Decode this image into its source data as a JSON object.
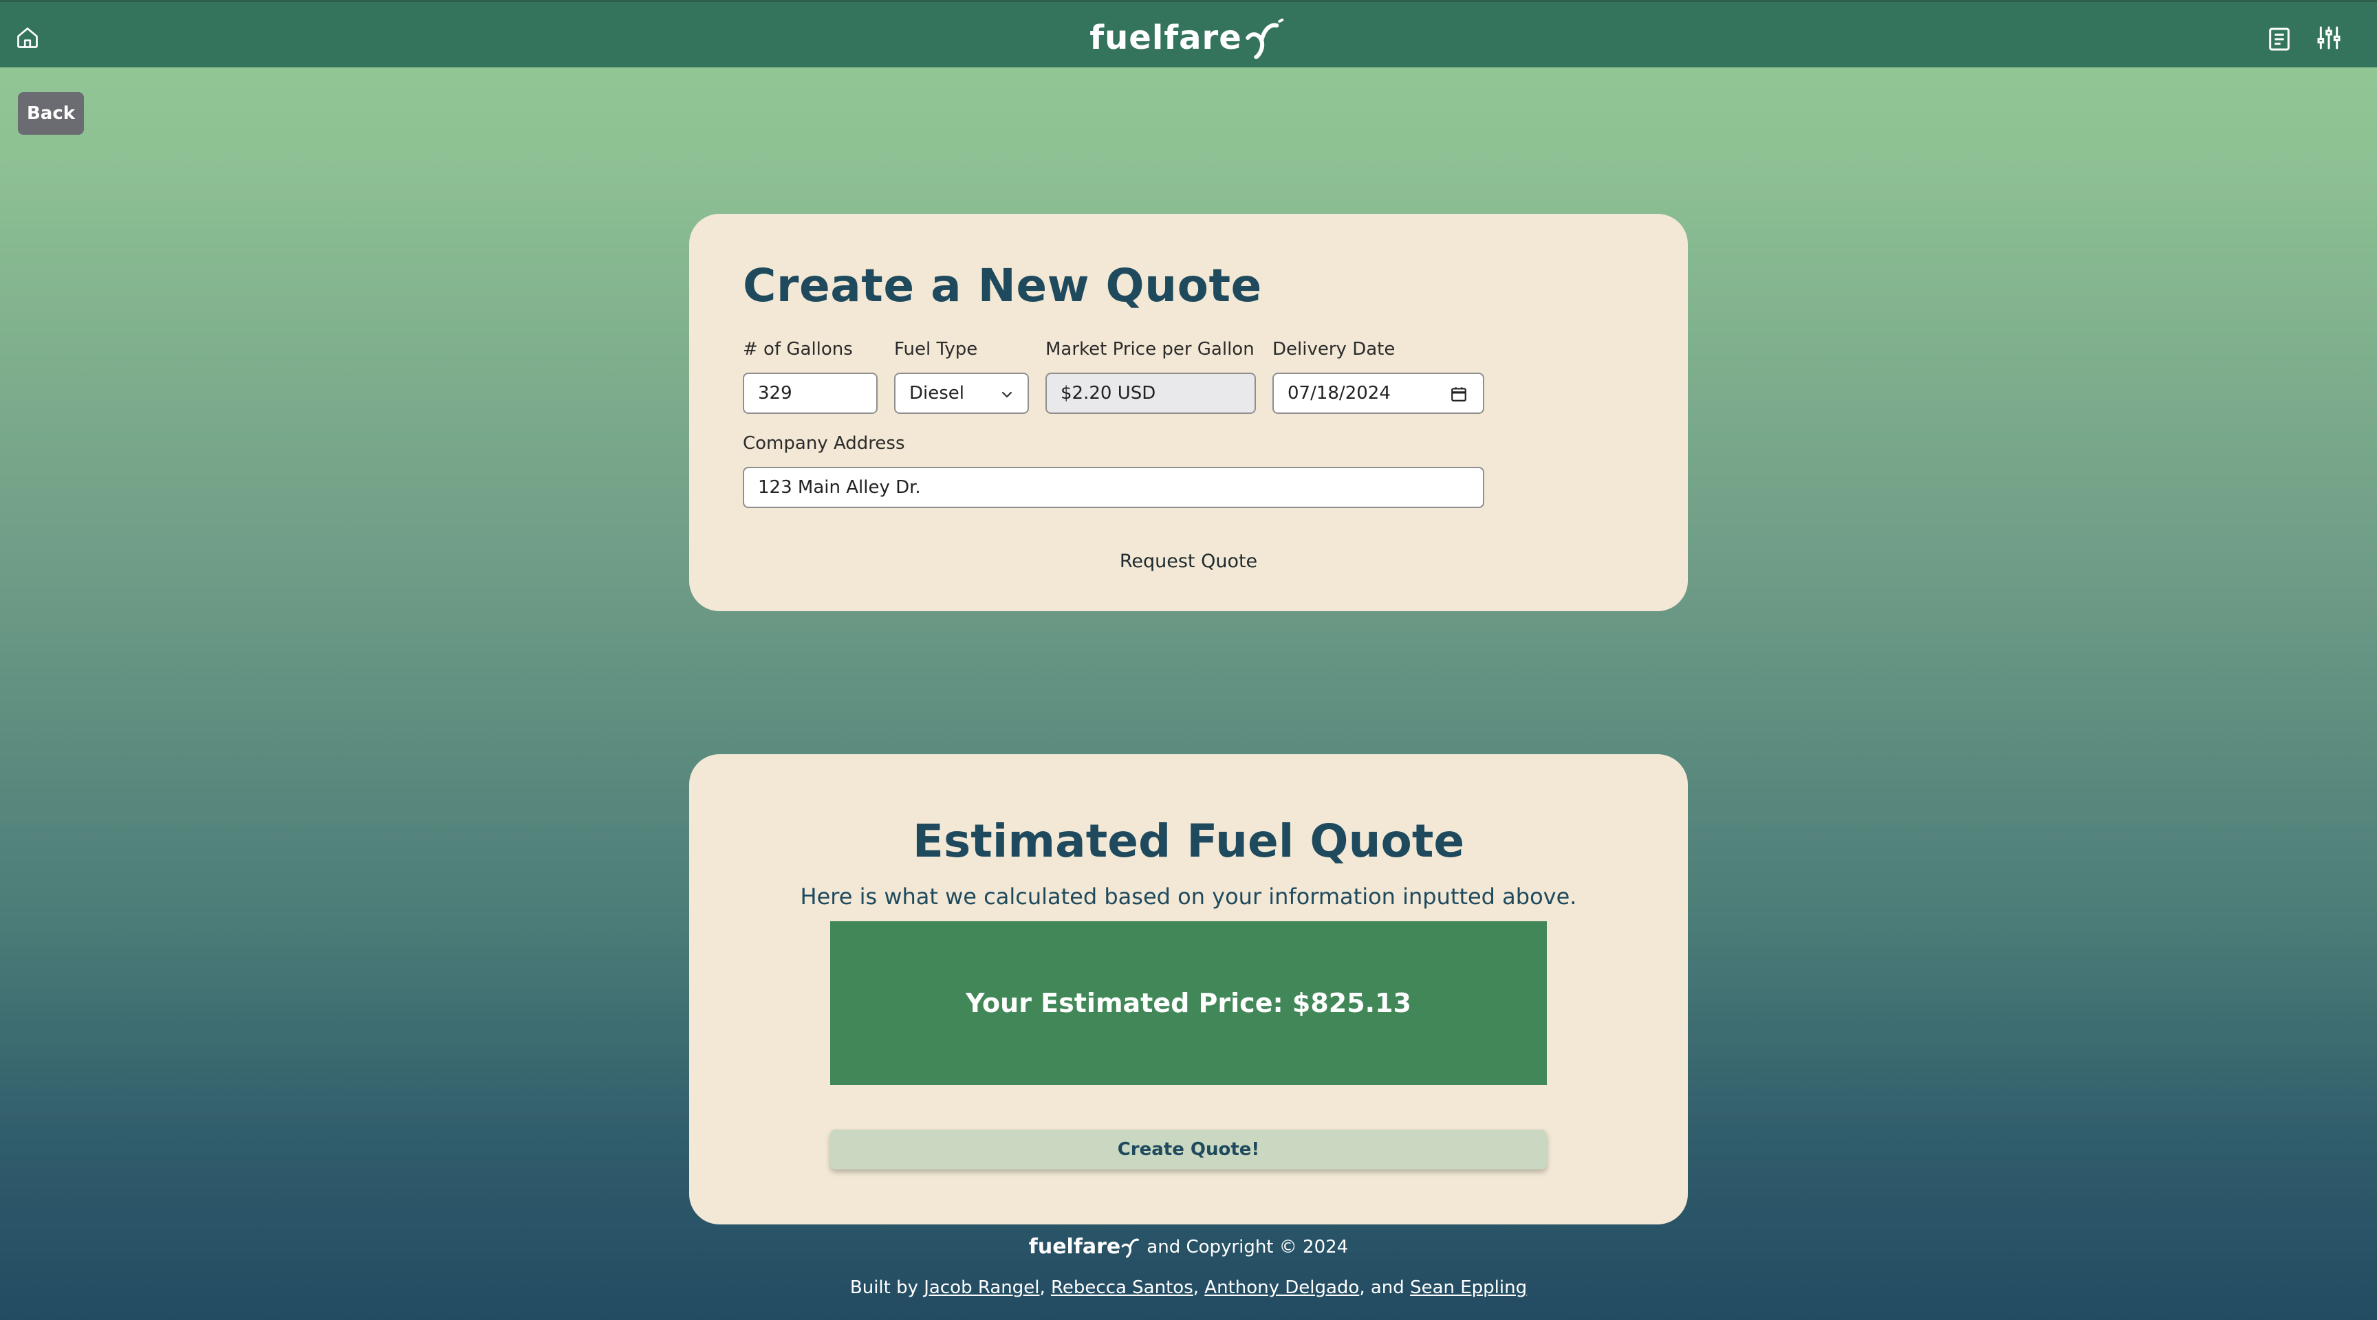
{
  "header": {
    "brand": "fuelfare",
    "home_icon": "home-icon",
    "history_icon": "document-list-icon",
    "settings_icon": "sliders-icon"
  },
  "nav": {
    "back_label": "Back"
  },
  "form": {
    "title": "Create a New Quote",
    "gallons_label": "# of Gallons",
    "gallons_value": "329",
    "fuel_type_label": "Fuel Type",
    "fuel_type_value": "Diesel",
    "market_price_label": "Market Price per Gallon",
    "market_price_value": "$2.20 USD",
    "delivery_date_label": "Delivery Date",
    "delivery_date_value": "07/18/2024",
    "address_label": "Company Address",
    "address_value": "123 Main Alley Dr.",
    "request_label": "Request Quote"
  },
  "result": {
    "title": "Estimated Fuel Quote",
    "subtitle": "Here is what we calculated based on your information inputted above.",
    "price_text": "Your Estimated Price: $825.13",
    "create_label": "Create Quote!"
  },
  "footer": {
    "brand": "fuelfare",
    "copyright": "and Copyright © 2024",
    "built_by": "Built by ",
    "author1": "Jacob Rangel",
    "sep1": ", ",
    "author2": "Rebecca Santos",
    "sep2": ", ",
    "author3": "Anthony Delgado",
    "sep3": ", and ",
    "author4": "Sean Eppling"
  },
  "colors": {
    "header_bg": "#35745c",
    "card_bg": "#f2e8d5",
    "title_text": "#1f4a5e",
    "price_box": "#418758",
    "create_button": "#cad8c1",
    "back_button": "#6b6b72"
  }
}
